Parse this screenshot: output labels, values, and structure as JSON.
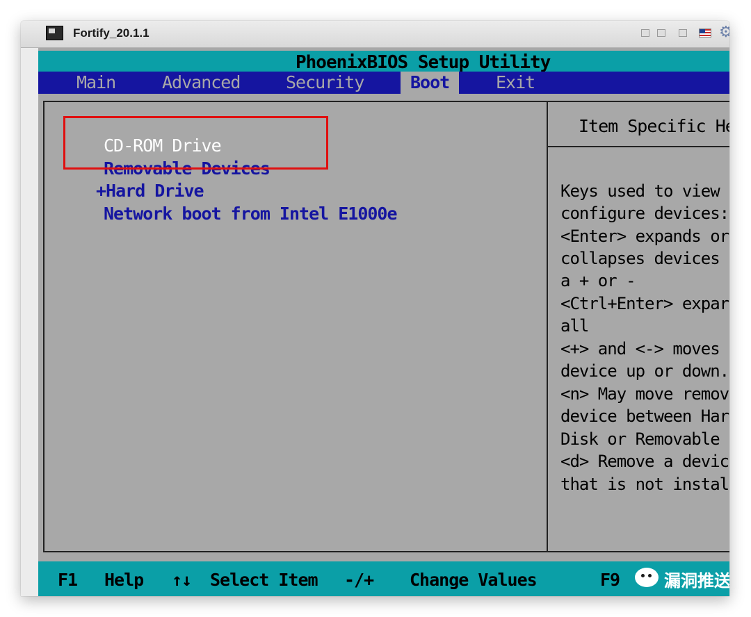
{
  "window": {
    "title": "Fortify_20.1.1",
    "icons": [
      "app-icon",
      "minimize-icon",
      "restore-icon",
      "maximize-icon",
      "flag-icon",
      "gear-icon"
    ]
  },
  "bios": {
    "title": "PhoenixBIOS Setup Utility",
    "menu": [
      {
        "label": "Main",
        "active": false
      },
      {
        "label": "Advanced",
        "active": false
      },
      {
        "label": "Security",
        "active": false
      },
      {
        "label": "Boot",
        "active": true
      },
      {
        "label": "Exit",
        "active": false
      }
    ],
    "boot_items": [
      {
        "label": "CD-ROM Drive",
        "selected": true
      },
      {
        "label": "Removable Devices",
        "selected": false
      },
      {
        "label": "+Hard Drive",
        "selected": false
      },
      {
        "label": "Network boot from Intel E1000e",
        "selected": false
      }
    ],
    "help": {
      "header": "Item Specific He",
      "lines": [
        "Keys used to view",
        "configure devices:",
        "<Enter> expands or",
        "collapses devices",
        "a + or -",
        "<Ctrl+Enter> expar",
        "all",
        "<+> and <-> moves",
        "device up or down.",
        "<n> May move remov",
        "device between Har",
        "Disk or Removable",
        "<d> Remove a devic",
        "that is not instal"
      ]
    },
    "status": {
      "f1_key": "F1",
      "f1_label": "Help",
      "arrows_key": "↑↓",
      "arrows_label": "Select Item",
      "change_key": "-/+",
      "change_label": "Change Values",
      "f9_key": "F9"
    },
    "watermark": "漏洞推送",
    "colors": {
      "cyan_bar": "#0b9fa7",
      "menu_blue": "#1515a0",
      "panel_gray": "#a8a8a8",
      "highlight_box": "#e01010"
    }
  }
}
